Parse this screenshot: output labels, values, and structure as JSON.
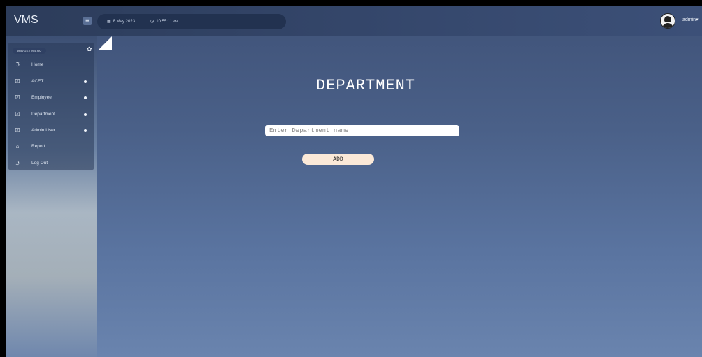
{
  "app": {
    "brand": "VMS"
  },
  "topbar": {
    "menu_toggle_glyph": "≡",
    "date": "8 May 2023",
    "time": "10:55:11",
    "time_suffix": "AM",
    "calendar_icon": "calendar-icon",
    "clock_icon": "clock-icon",
    "user_name": "admin",
    "user_caret": "▾"
  },
  "sidebar": {
    "title": "WIDGET MENU",
    "gear_glyph": "✿",
    "items": [
      {
        "label": "Home",
        "icon": "feed-icon",
        "glyph": "ℑ",
        "has_dot": false
      },
      {
        "label": "ACET",
        "icon": "edit-icon",
        "glyph": "☑",
        "has_dot": true
      },
      {
        "label": "Employee",
        "icon": "edit-icon",
        "glyph": "☑",
        "has_dot": true
      },
      {
        "label": "Department",
        "icon": "edit-icon",
        "glyph": "☑",
        "has_dot": true
      },
      {
        "label": "Admin User",
        "icon": "edit-icon",
        "glyph": "☑",
        "has_dot": true
      },
      {
        "label": "Report",
        "icon": "camera-icon",
        "glyph": "⌂",
        "has_dot": false
      },
      {
        "label": "Log Out",
        "icon": "feed-icon",
        "glyph": "ℑ",
        "has_dot": false
      }
    ]
  },
  "main": {
    "title": "DEPARTMENT",
    "input_placeholder": "Enter Department name",
    "input_value": "",
    "add_label": "ADD"
  },
  "colors": {
    "accent_button": "#fbe9d8",
    "topbar": "#2c3c5a",
    "content_bg": "#4a6088"
  }
}
